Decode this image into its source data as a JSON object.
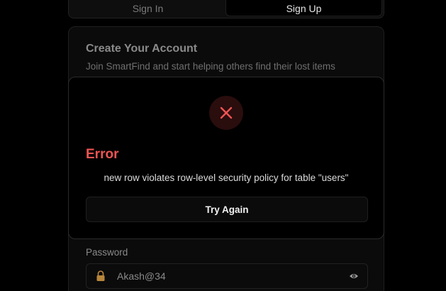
{
  "tabs": [
    {
      "label": "Sign In",
      "active": false
    },
    {
      "label": "Sign Up",
      "active": true
    }
  ],
  "card": {
    "title": "Create Your Account",
    "subtitle": "Join SmartFind and start helping others find their lost items",
    "password_label": "Password",
    "password_value": "Akash@34"
  },
  "modal": {
    "title": "Error",
    "message": "new row violates row-level security policy for table \"users\"",
    "button_label": "Try Again",
    "icon": "close-icon"
  },
  "colors": {
    "background": "#000000",
    "error": "#ef5454",
    "error_icon_bg": "#2a0d0d",
    "lock_icon": "#b8863b"
  }
}
